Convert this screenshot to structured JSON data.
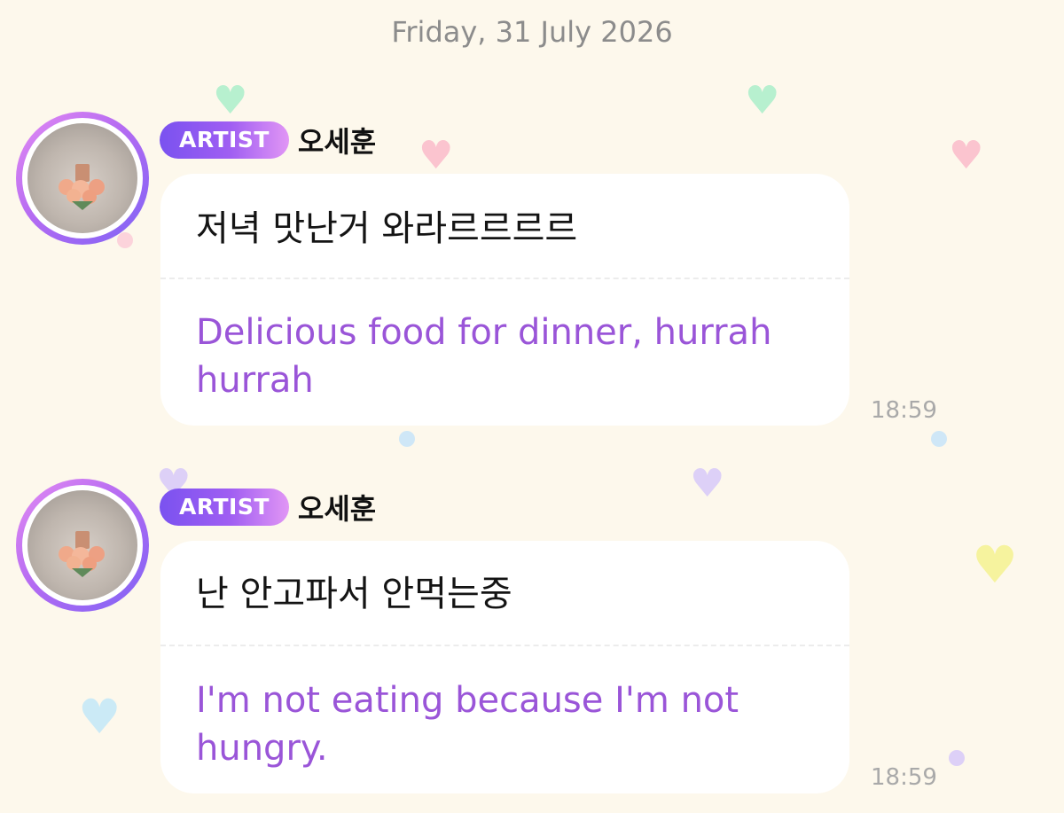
{
  "date_header": "Friday, 31 July 2026",
  "messages": [
    {
      "badge": "ARTIST",
      "sender": "오세훈",
      "original": "저녁 맛난거 와라르르르르",
      "translation": "Delicious food for dinner, hurrah hurrah",
      "time": "18:59"
    },
    {
      "badge": "ARTIST",
      "sender": "오세훈",
      "original": "난 안고파서 안먹는중",
      "translation": "I'm not eating because I'm not hungry.",
      "time": "18:59"
    }
  ],
  "colors": {
    "background": "#fdf8ec",
    "badge_gradient_start": "#7a52f0",
    "badge_gradient_end": "#e196f5",
    "translation_text": "#9a55d8",
    "timestamp_text": "#a9a9a9"
  },
  "icons": {
    "decoration": "heart-icon",
    "avatar": "bouquet-photo"
  }
}
